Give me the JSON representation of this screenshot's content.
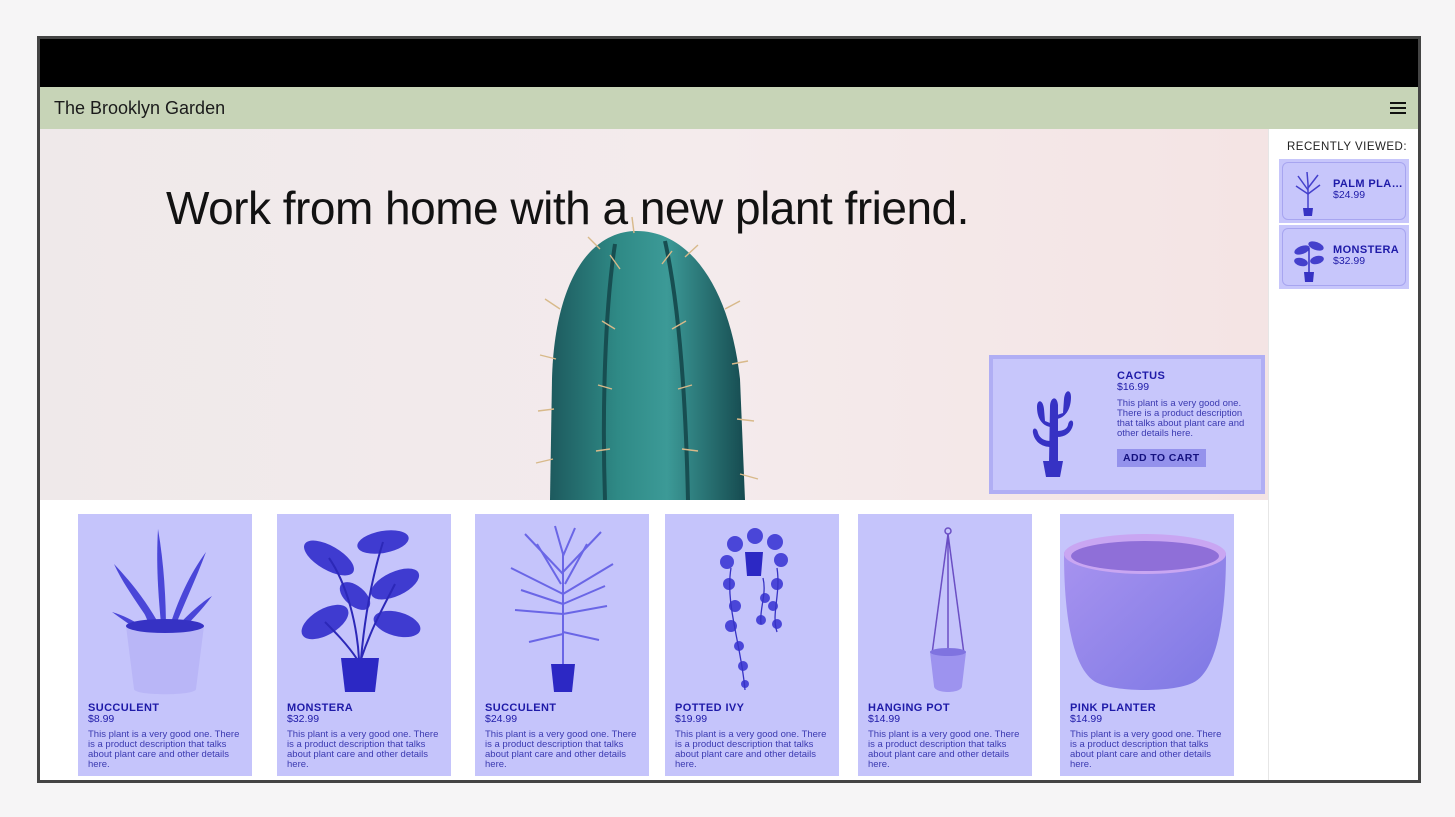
{
  "header": {
    "brand": "The Brooklyn Garden",
    "menu_icon": "hamburger-icon"
  },
  "hero": {
    "headline": "Work from home with a new plant friend."
  },
  "featured": {
    "name": "CACTUS",
    "price": "$16.99",
    "description": "This plant is a very good one. There is a product description that talks about plant care and other details here.",
    "button_label": "ADD TO CART"
  },
  "recently_viewed": {
    "title": "RECENTLY VIEWED:",
    "items": [
      {
        "name": "PALM PLANT",
        "price": "$24.99"
      },
      {
        "name": "MONSTERA",
        "price": "$32.99"
      }
    ]
  },
  "products": [
    {
      "name": "SUCCULENT",
      "price": "$8.99",
      "description": "This plant is a very good one. There is a product description that talks about plant care and other details here."
    },
    {
      "name": "MONSTERA",
      "price": "$32.99",
      "description": "This plant is a very good one. There is a product description that talks about plant care and other details here."
    },
    {
      "name": "SUCCULENT",
      "price": "$24.99",
      "description": "This plant is a very good one. There is a product description that talks about plant care and other details here."
    },
    {
      "name": "POTTED IVY",
      "price": "$19.99",
      "description": "This plant is a very good one. There is a product description that talks about plant care and other details here."
    },
    {
      "name": "HANGING POT",
      "price": "$14.99",
      "description": "This plant is a very good one. There is a product description that talks about plant care and other details here."
    },
    {
      "name": "PINK PLANTER",
      "price": "$14.99",
      "description": "This plant is a very good one. There is a product description that talks about plant care and other details here."
    }
  ],
  "colors": {
    "navbar": "#c7d4b7",
    "card": "#c5c4fb",
    "accent": "#1e1aa8",
    "button": "#9492ec"
  }
}
